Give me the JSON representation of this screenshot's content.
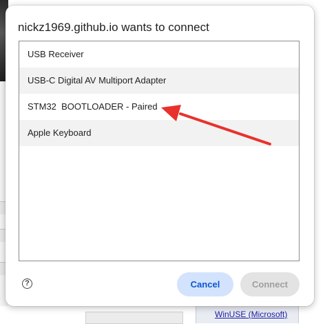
{
  "dialog": {
    "title": "nickz1969.github.io wants to connect",
    "devices": [
      {
        "label": "USB Receiver"
      },
      {
        "label": "USB-C Digital AV Multiport Adapter"
      },
      {
        "label": "STM32  BOOTLOADER - Paired"
      },
      {
        "label": "Apple Keyboard"
      }
    ],
    "help_glyph": "?",
    "cancel_label": "Cancel",
    "connect_label": "Connect"
  },
  "background": {
    "bottom_link": "WinUSE (Microsoft)"
  },
  "annotation": {
    "arrow_color": "#e8322d",
    "points_to": "STM32  BOOTLOADER - Paired"
  },
  "colors": {
    "cancel_bg": "#d3e3fd",
    "cancel_text": "#0b57d0",
    "connect_bg_disabled": "#e3e3e3",
    "alt_row": "#f2f2f2"
  }
}
